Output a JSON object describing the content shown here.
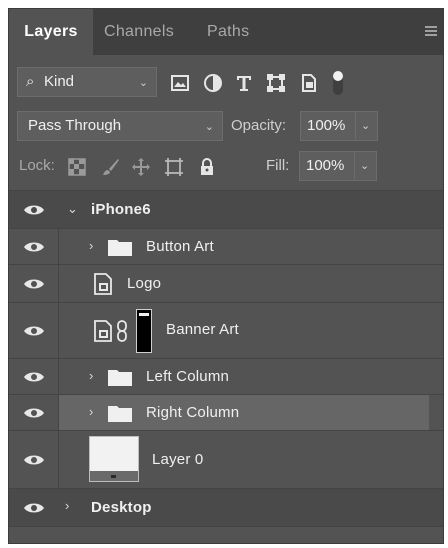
{
  "tabs": [
    {
      "label": "Layers",
      "active": true
    },
    {
      "label": "Channels",
      "active": false
    },
    {
      "label": "Paths",
      "active": false
    }
  ],
  "filter": {
    "kind_label": "Kind",
    "icons": [
      "pixel-layer-filter-icon",
      "adjustment-layer-filter-icon",
      "type-layer-filter-icon",
      "shape-layer-filter-icon",
      "smart-object-filter-icon",
      "filter-toggle-icon"
    ]
  },
  "blend": {
    "mode": "Pass Through",
    "opacity_label": "Opacity:",
    "opacity_value": "100%"
  },
  "lock": {
    "label": "Lock:",
    "icons": [
      "lock-transparent-pixels-icon",
      "lock-image-pixels-icon",
      "lock-position-icon",
      "lock-artboard-icon",
      "lock-all-icon"
    ],
    "fill_label": "Fill:",
    "fill_value": "100%"
  },
  "layers": [
    {
      "name": "iPhone6",
      "type": "artboard",
      "expanded": true
    },
    {
      "name": "Button Art",
      "type": "group",
      "expanded": false
    },
    {
      "name": "Logo",
      "type": "smart-object"
    },
    {
      "name": "Banner Art",
      "type": "smart-object-mask"
    },
    {
      "name": "Left Column",
      "type": "group",
      "expanded": false
    },
    {
      "name": "Right Column",
      "type": "group",
      "expanded": false,
      "selected": true
    },
    {
      "name": "Layer 0",
      "type": "pixel"
    },
    {
      "name": "Desktop",
      "type": "artboard",
      "expanded": false
    }
  ],
  "colors": {
    "panel_bg": "#535353",
    "artboard_row_bg": "#4a4a4a",
    "selected_row_bg": "#666666",
    "tab_bar_bg": "#3f3f3f"
  }
}
